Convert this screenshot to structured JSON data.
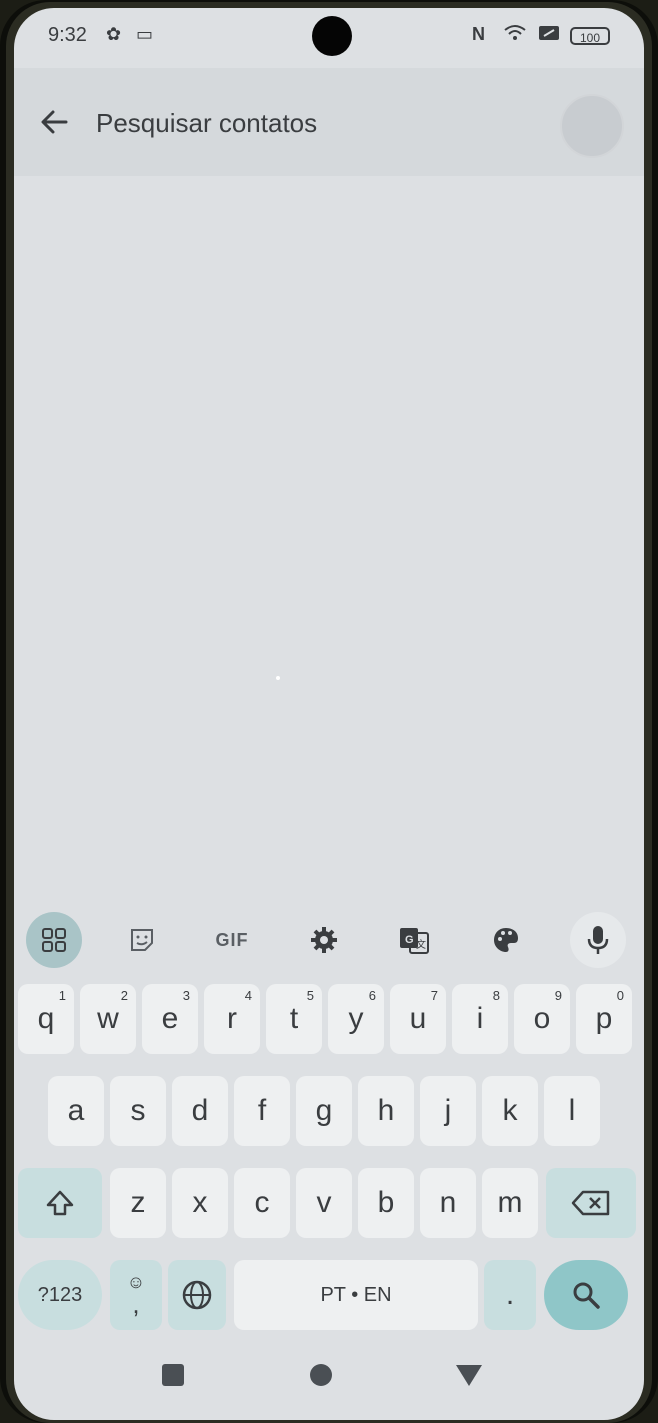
{
  "status_bar": {
    "time": "9:32",
    "nfc_icon": "nfc-icon",
    "wifi_icon": "wifi-icon",
    "battery": "100"
  },
  "search": {
    "placeholder": "Pesquisar contatos"
  },
  "toolbar": {
    "gif_label": "GIF"
  },
  "keyboard": {
    "row1": [
      {
        "key": "q",
        "hint": "1"
      },
      {
        "key": "w",
        "hint": "2"
      },
      {
        "key": "e",
        "hint": "3"
      },
      {
        "key": "r",
        "hint": "4"
      },
      {
        "key": "t",
        "hint": "5"
      },
      {
        "key": "y",
        "hint": "6"
      },
      {
        "key": "u",
        "hint": "7"
      },
      {
        "key": "i",
        "hint": "8"
      },
      {
        "key": "o",
        "hint": "9"
      },
      {
        "key": "p",
        "hint": "0"
      }
    ],
    "row2": [
      "a",
      "s",
      "d",
      "f",
      "g",
      "h",
      "j",
      "k",
      "l"
    ],
    "row3": [
      "z",
      "x",
      "c",
      "v",
      "b",
      "n",
      "m"
    ],
    "symbols_label": "?123",
    "emoji_key": "☺",
    "comma_key": ",",
    "space_label": "PT • EN",
    "period_key": "."
  },
  "colors": {
    "accent": "#8fc6c8",
    "screen_bg": "#dde0e3"
  }
}
